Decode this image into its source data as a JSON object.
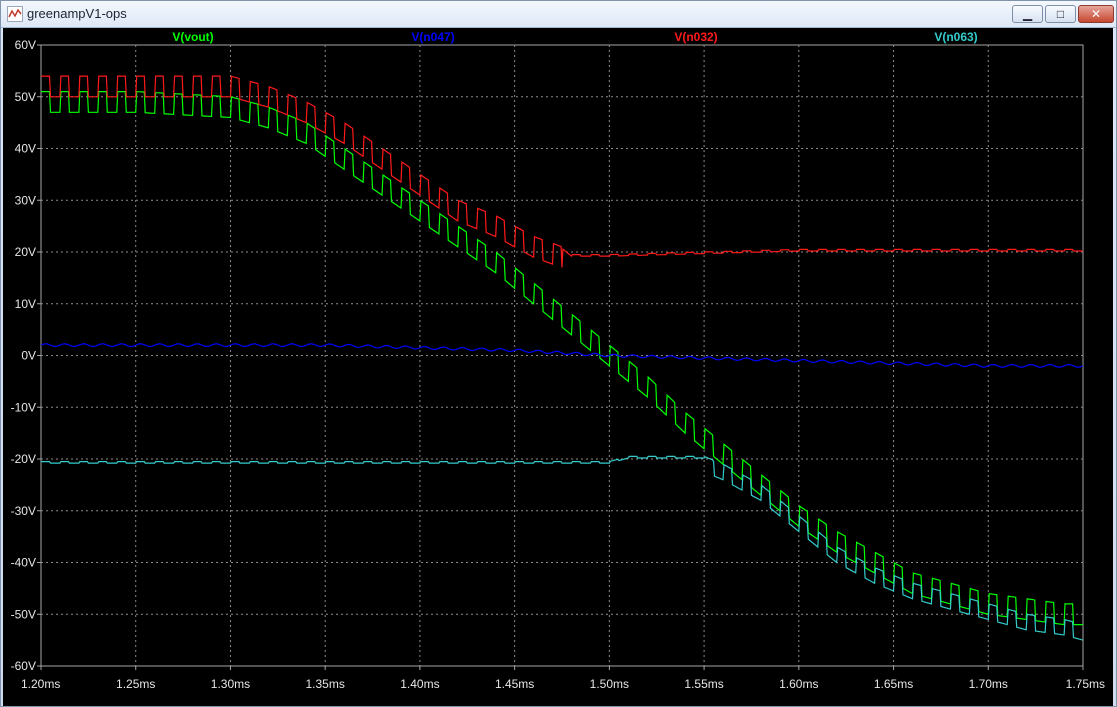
{
  "window": {
    "title": "greenampV1-ops",
    "minimize_icon": "minimize-icon",
    "maximize_icon": "maximize-icon",
    "close_icon": "close-icon"
  },
  "chart_data": {
    "type": "line",
    "xlim": [
      1.2,
      1.75
    ],
    "ylim": [
      -60,
      60
    ],
    "x_ticks": [
      "1.20ms",
      "1.25ms",
      "1.30ms",
      "1.35ms",
      "1.40ms",
      "1.45ms",
      "1.50ms",
      "1.55ms",
      "1.60ms",
      "1.65ms",
      "1.70ms",
      "1.75ms"
    ],
    "y_ticks": [
      "60V",
      "50V",
      "40V",
      "30V",
      "20V",
      "10V",
      "0V",
      "-10V",
      "-20V",
      "-30V",
      "-40V",
      "-50V",
      "-60V"
    ],
    "grid": true,
    "series": [
      {
        "name": "V(vout)",
        "color": "#00ff00",
        "x": [
          1.2,
          1.25,
          1.3,
          1.32,
          1.34,
          1.36,
          1.38,
          1.4,
          1.42,
          1.44,
          1.46,
          1.48,
          1.5,
          1.52,
          1.54,
          1.56,
          1.58,
          1.6,
          1.62,
          1.64,
          1.66,
          1.68,
          1.7,
          1.72,
          1.74,
          1.75
        ],
        "y": [
          51,
          51,
          50,
          48,
          45,
          40,
          35,
          30,
          25,
          20,
          14,
          8,
          2,
          -4,
          -11,
          -17,
          -23,
          -29,
          -34,
          -38,
          -42,
          -44,
          -46,
          -47,
          -48,
          -48
        ],
        "ripple": 4
      },
      {
        "name": "V(n047)",
        "color": "#0000ff",
        "x": [
          1.2,
          1.3,
          1.35,
          1.4,
          1.45,
          1.5,
          1.55,
          1.6,
          1.65,
          1.7,
          1.75
        ],
        "y": [
          2,
          2,
          2,
          1.5,
          1,
          0,
          -0.5,
          -1,
          -1.5,
          -2,
          -2
        ]
      },
      {
        "name": "V(n032)",
        "color": "#ff1a1a",
        "x": [
          1.2,
          1.25,
          1.3,
          1.32,
          1.34,
          1.36,
          1.38,
          1.4,
          1.42,
          1.44,
          1.46,
          1.475,
          1.48,
          1.5,
          1.55,
          1.6,
          1.65,
          1.7,
          1.75
        ],
        "y": [
          54,
          54,
          54,
          52,
          49,
          45,
          40,
          35,
          30,
          27,
          23,
          21,
          19.5,
          19.5,
          20,
          20.5,
          20.5,
          20.5,
          20.5
        ],
        "ripple": 4
      },
      {
        "name": "V(n063)",
        "color": "#33cccc",
        "x": [
          1.2,
          1.3,
          1.4,
          1.45,
          1.5,
          1.51,
          1.55,
          1.56,
          1.58,
          1.6,
          1.62,
          1.64,
          1.66,
          1.68,
          1.7,
          1.72,
          1.74,
          1.75
        ],
        "y": [
          -20.5,
          -20.5,
          -20.5,
          -20.5,
          -20.5,
          -19.5,
          -19.5,
          -21,
          -25,
          -31,
          -37,
          -41,
          -44,
          -46,
          -48,
          -50,
          -51,
          -52
        ],
        "ripple": 3
      }
    ]
  }
}
